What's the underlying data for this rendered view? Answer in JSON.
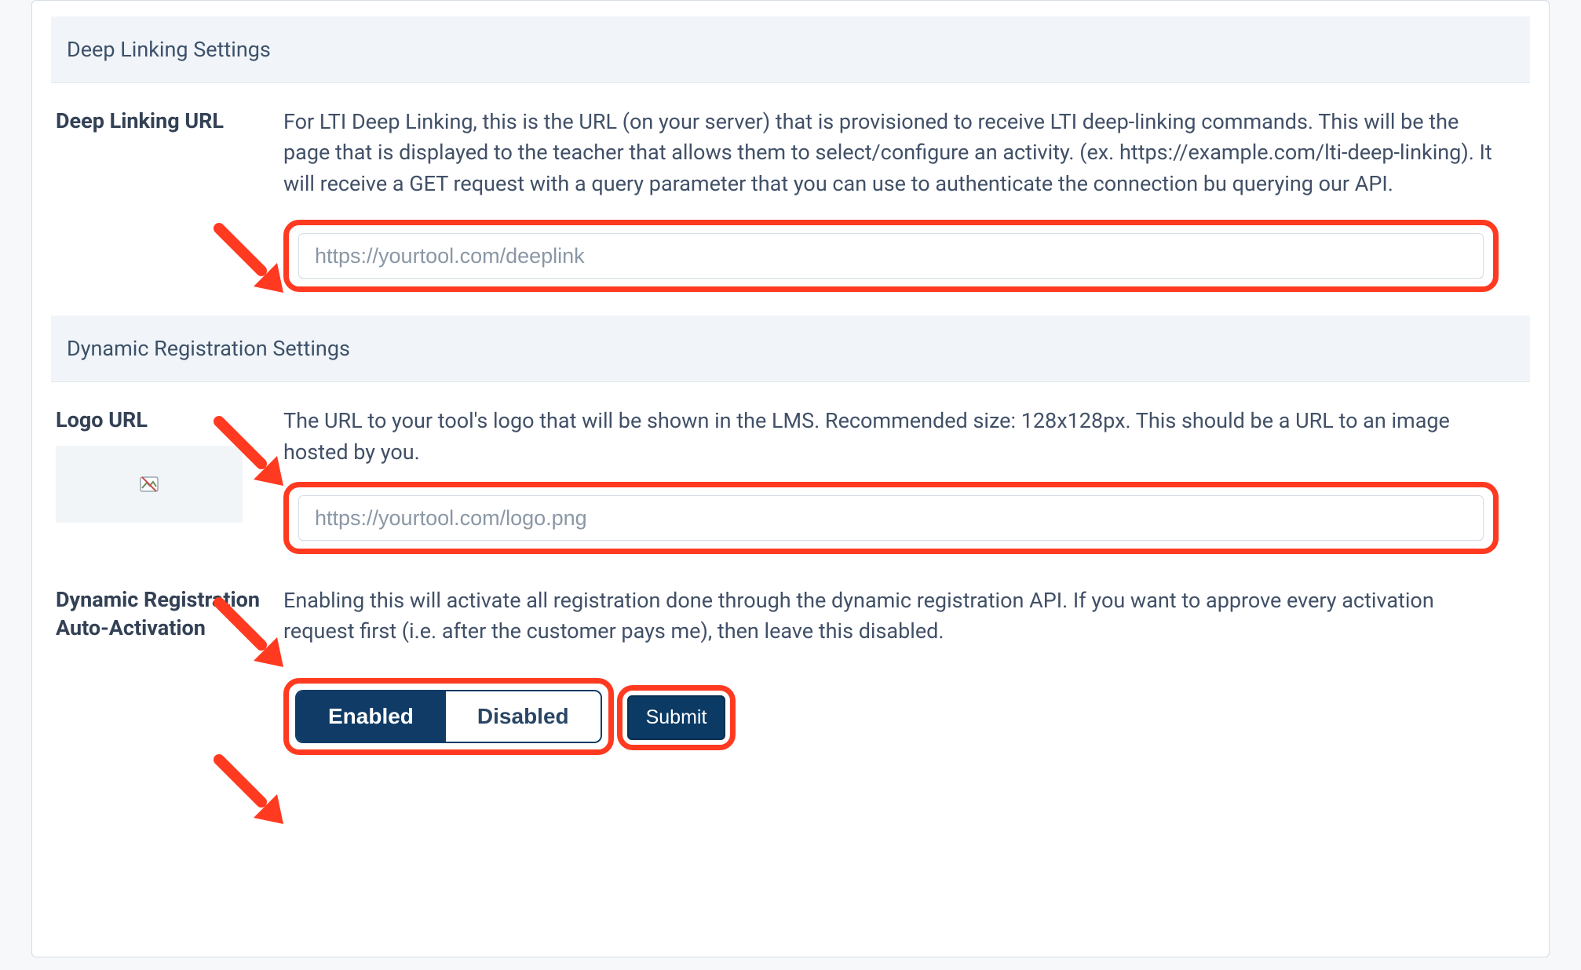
{
  "sections": {
    "deep_linking": {
      "header": "Deep Linking Settings",
      "url_field": {
        "label": "Deep Linking URL",
        "description": "For LTI Deep Linking, this is the URL (on your server) that is provisioned to receive LTI deep-linking commands. This will be the page that is displayed to the teacher that allows them to select/configure an activity. (ex. https://example.com/lti-deep-linking). It will receive a GET request with a query parameter that you can use to authenticate the connection bu querying our API.",
        "placeholder": "https://yourtool.com/deeplink",
        "value": ""
      }
    },
    "dynamic_registration": {
      "header": "Dynamic Registration Settings",
      "logo_field": {
        "label": "Logo URL",
        "description": "The URL to your tool's logo that will be shown in the LMS. Recommended size: 128x128px. This should be a URL to an image hosted by you.",
        "placeholder": "https://yourtool.com/logo.png",
        "value": ""
      },
      "auto_activation": {
        "label": "Dynamic Registration Auto-Activation",
        "description": "Enabling this will activate all registration done through the dynamic registration API. If you want to approve every activation request first (i.e. after the customer pays me), then leave this disabled.",
        "options": {
          "enabled": "Enabled",
          "disabled": "Disabled"
        },
        "selected": "enabled"
      },
      "submit_label": "Submit"
    }
  },
  "colors": {
    "highlight": "#ff3a20",
    "accent": "#0f3b66"
  }
}
